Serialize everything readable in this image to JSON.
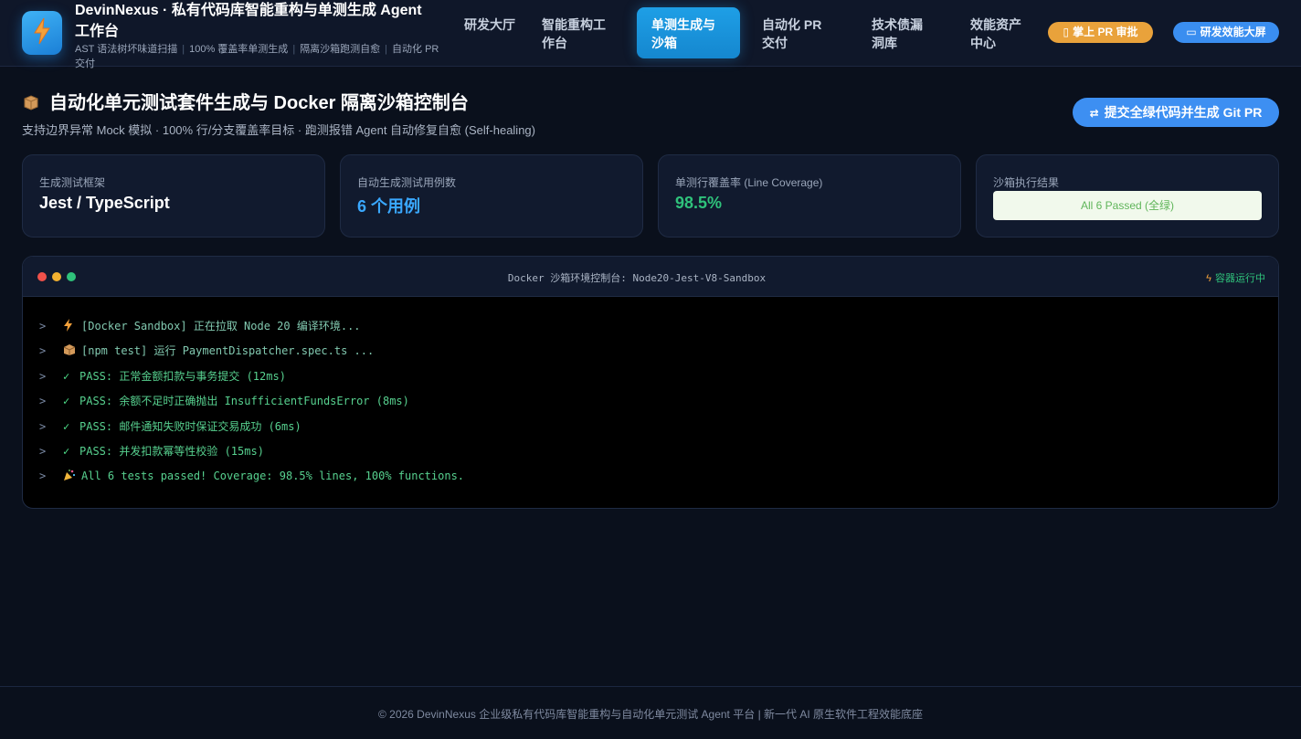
{
  "header": {
    "title": "DevinNexus · 私有代码库智能重构与单测生成 Agent 工作台",
    "subtitle_items": [
      "AST 语法树坏味道扫描",
      "100% 覆盖率单测生成",
      "隔离沙箱跑测自愈",
      "自动化 PR 交付"
    ],
    "nav": [
      {
        "label": "研发大厅"
      },
      {
        "label": "智能重构工作台"
      },
      {
        "label": "单测生成与沙箱"
      },
      {
        "label": "自动化 PR 交付"
      },
      {
        "label": "技术债漏洞库"
      },
      {
        "label": "效能资产中心"
      }
    ],
    "active_tab": "单测生成与沙箱",
    "pr_review_button": "掌上 PR 审批",
    "dashboard_button": "研发效能大屏"
  },
  "page": {
    "title": "自动化单元测试套件生成与 Docker 隔离沙箱控制台",
    "subtitle": "支持边界异常 Mock 模拟 · 100% 行/分支覆盖率目标 · 跑测报错 Agent 自动修复自愈 (Self-healing)",
    "submit_button": "提交全绿代码并生成 Git PR"
  },
  "stats": {
    "framework_label": "生成测试框架",
    "framework_value": "Jest / TypeScript",
    "cases_label": "自动生成测试用例数",
    "cases_value": "6 个用例",
    "coverage_label": "单测行覆盖率 (Line Coverage)",
    "coverage_value": "98.5%",
    "result_label": "沙箱执行结果",
    "result_value": "All 6 Passed (全绿)"
  },
  "terminal": {
    "title": "Docker 沙箱环境控制台: Node20-Jest-V8-Sandbox",
    "status": "容器运行中",
    "lines": [
      {
        "icon": "lightning-icon",
        "text": "[Docker Sandbox] 正在拉取 Node 20 编译环境..."
      },
      {
        "icon": "package-icon",
        "text": "[npm test] 运行 PaymentDispatcher.spec.ts ..."
      },
      {
        "icon": "check-icon",
        "text": "PASS: 正常金额扣款与事务提交 (12ms)"
      },
      {
        "icon": "check-icon",
        "text": "PASS: 余额不足时正确抛出 InsufficientFundsError (8ms)"
      },
      {
        "icon": "check-icon",
        "text": "PASS: 邮件通知失败时保证交易成功 (6ms)"
      },
      {
        "icon": "check-icon",
        "text": "PASS: 并发扣款幂等性校验 (15ms)"
      },
      {
        "icon": "party-icon",
        "text": "All 6 tests passed! Coverage: 98.5% lines, 100% functions."
      }
    ]
  },
  "footer": {
    "text": "© 2026 DevinNexus 企业级私有代码库智能重构与自动化单元测试 Agent 平台 | 新一代 AI 原生软件工程效能底座"
  },
  "colors": {
    "accent": "#1e9fe6",
    "coverage": "#2fc27b",
    "cases": "#3aa8ff",
    "warning": "#e9a23b"
  }
}
